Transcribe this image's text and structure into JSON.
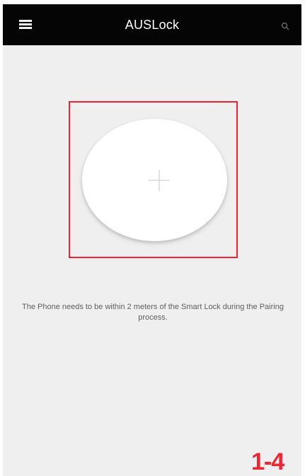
{
  "app": {
    "title": "AUSLock"
  },
  "header": {
    "menu_icon": "menu-icon",
    "search_icon": "search-icon"
  },
  "pairing": {
    "add_icon": "plus-icon",
    "instruction": "The Phone needs to be within 2 meters of the Smart Lock during the Pairing process.",
    "highlight_color": "#f2232f"
  },
  "annotation": {
    "step_label": "1-4",
    "color": "#ef2632"
  }
}
